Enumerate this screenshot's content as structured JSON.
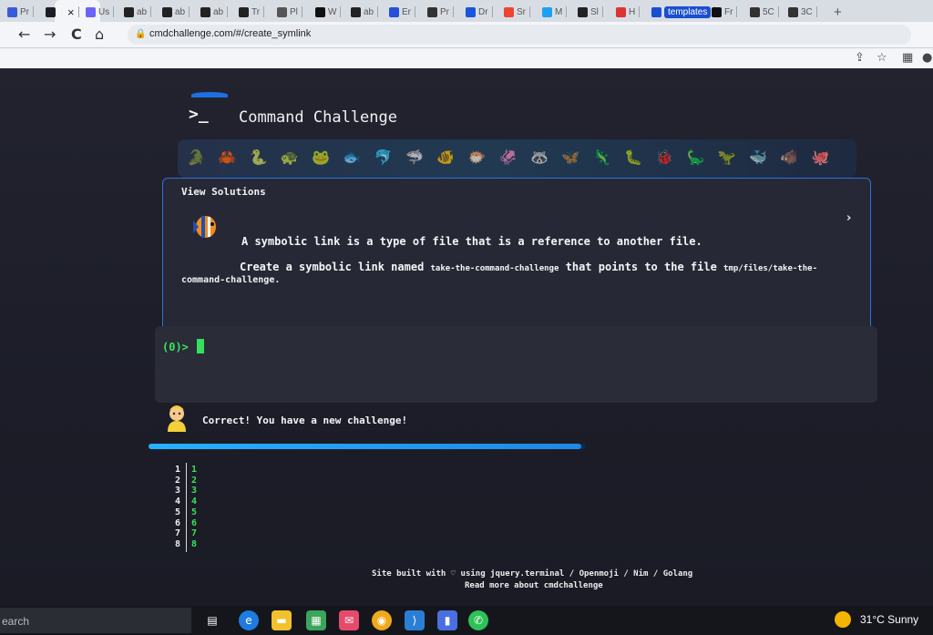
{
  "browser": {
    "tabs": [
      {
        "label": "Pr",
        "color": "#3b5bd6"
      },
      {
        "label": "",
        "color": "#1c1d28"
      },
      {
        "label": "Us",
        "color": "#6c63ff"
      },
      {
        "label": "ab",
        "color": "#222222"
      },
      {
        "label": "ab",
        "color": "#222222"
      },
      {
        "label": "ab",
        "color": "#222222"
      },
      {
        "label": "Tr",
        "color": "#222222"
      },
      {
        "label": "Pl",
        "color": "#555555"
      },
      {
        "label": "W",
        "color": "#111111"
      },
      {
        "label": "ab",
        "color": "#222222"
      },
      {
        "label": "Er",
        "color": "#2451d8"
      },
      {
        "label": "Pr",
        "color": "#333333"
      },
      {
        "label": "Dr",
        "color": "#1a56db"
      },
      {
        "label": "Sr",
        "color": "#e43"
      },
      {
        "label": "M",
        "color": "#1da1f2"
      },
      {
        "label": "Sl",
        "color": "#222222"
      },
      {
        "label": "H",
        "color": "#d33"
      },
      {
        "label": "templates",
        "color": "#1a4fd0"
      },
      {
        "label": "Fr",
        "color": "#111111"
      },
      {
        "label": "5C",
        "color": "#333333"
      },
      {
        "label": "3C",
        "color": "#333333"
      }
    ],
    "close_tab": "×",
    "new_tab": "+",
    "url": "cmdchallenge.com/#/create_symlink",
    "back": "←",
    "forward": "→",
    "reload": "C",
    "home": "⌂"
  },
  "site": {
    "logo_glyph": ">_",
    "title": "Command Challenge",
    "emoji_strip": [
      "🐊",
      "🦀",
      "🐍",
      "🐢",
      "🐸",
      "🐟",
      "🐬",
      "🦈",
      "🐠",
      "🐡",
      "🦑",
      "🦝",
      "🦋",
      "🦎",
      "🐛",
      "🐞",
      "🦕",
      "🦖",
      "🐳",
      "🐗",
      "🐙"
    ],
    "view_solutions": "View Solutions",
    "chevron": "›",
    "description_line1": "A symbolic link is a type of file that is a reference to another file.",
    "description_line2_prefix": "Create a symbolic link named ",
    "description_code1": "take-the-command-challenge",
    "description_line2_middle": " that points to the file ",
    "description_code2": "tmp/files/take-the-",
    "description_code2_cont": "command-challenge",
    "description_end": ".",
    "prompt": "(0)>",
    "success_message": "Correct! You have a new challenge!",
    "progress_fraction": 0.99,
    "line_numbers": [
      "1",
      "2",
      "3",
      "4",
      "5",
      "6",
      "7",
      "8"
    ],
    "completed_levels": [
      "1",
      "2",
      "3",
      "4",
      "5",
      "6",
      "7",
      "8"
    ],
    "footer_line1": "Site built with ♡ using jquery.terminal / Openmoji / Nim / Golang",
    "footer_line2": "Read more about cmdchallenge"
  },
  "taskbar": {
    "search_placeholder": "earch",
    "weather": "31°C  Sunny"
  },
  "colors": {
    "accent_blue": "#2f6fe0",
    "prompt_green": "#37e65b",
    "page_background": "#1d1e29"
  }
}
